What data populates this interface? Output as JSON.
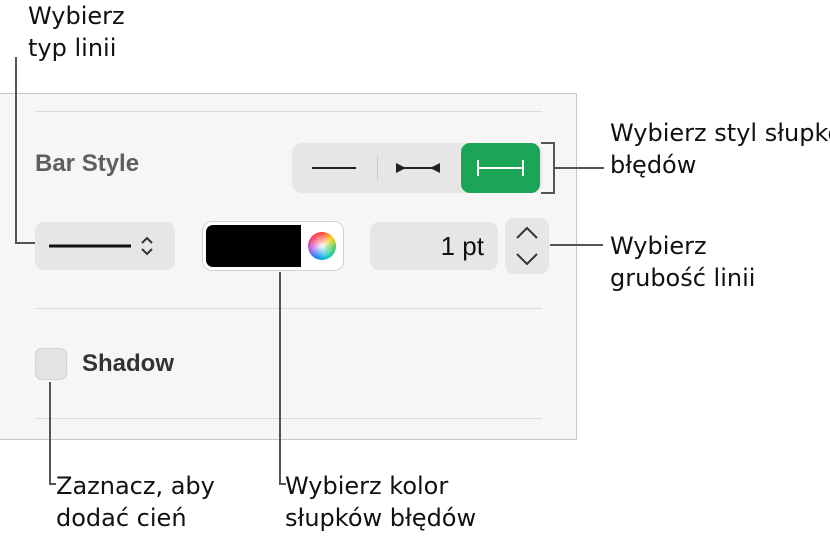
{
  "callouts": {
    "line_type": [
      "Wybierz",
      "typ linii"
    ],
    "bar_style": [
      "Wybierz styl słupków",
      "błędów"
    ],
    "line_width": [
      "Wybierz",
      "grubość linii"
    ],
    "shadow": [
      "Zaznacz, aby",
      "dodać cień"
    ],
    "bar_color": [
      "Wybierz kolor",
      "słupków błędów"
    ]
  },
  "panel": {
    "bar_style_label": "Bar Style",
    "bar_style_options": [
      "line",
      "line-with-arrows",
      "line-with-caps"
    ],
    "selected_bar_style": "line-with-caps",
    "line_width_value": "1 pt",
    "error_bar_color": "#000000",
    "accent_color": "#1aa656",
    "shadow_label": "Shadow",
    "shadow_checked": false
  }
}
